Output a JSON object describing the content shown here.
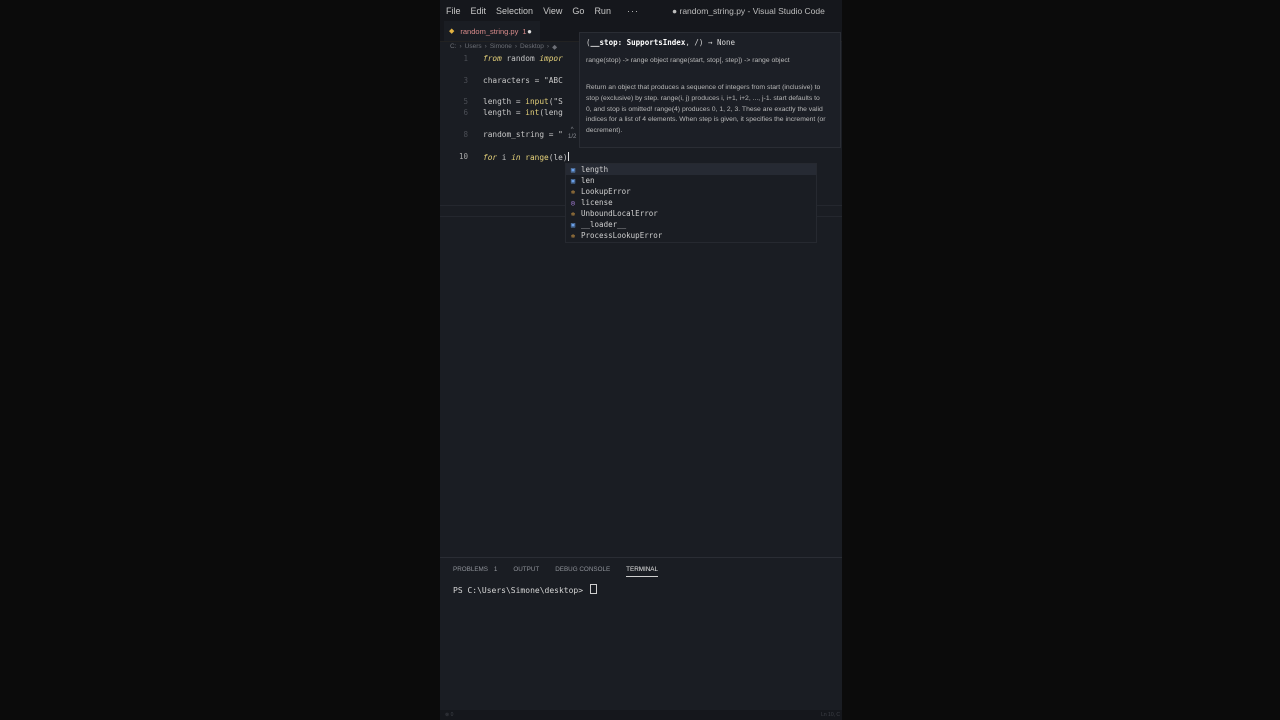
{
  "titlebar": {
    "menu": [
      "File",
      "Edit",
      "Selection",
      "View",
      "Go",
      "Run"
    ],
    "more": "···",
    "window_title": "● random_string.py - Visual Studio Code"
  },
  "tab": {
    "icon": "◆",
    "name": "random_string.py",
    "problem_count": "1",
    "dirty": "●"
  },
  "breadcrumb": [
    "C:",
    "›",
    "Users",
    "›",
    "Simone",
    "›",
    "Desktop",
    "›",
    "◆"
  ],
  "editor": {
    "lines": [
      {
        "num": "1",
        "parts": [
          {
            "t": "from",
            "c": "kw"
          },
          {
            "t": " random ",
            "c": ""
          },
          {
            "t": "impor",
            "c": "kw"
          }
        ]
      },
      {
        "num": "2",
        "parts": []
      },
      {
        "num": "3",
        "parts": [
          {
            "t": "characters = \"ABC",
            "c": ""
          }
        ]
      },
      {
        "num": "4",
        "parts": []
      },
      {
        "num": "5",
        "parts": [
          {
            "t": "length = ",
            "c": ""
          },
          {
            "t": "input",
            "c": "fn"
          },
          {
            "t": "(\"S",
            "c": ""
          }
        ]
      },
      {
        "num": "6",
        "parts": [
          {
            "t": "length = ",
            "c": ""
          },
          {
            "t": "int",
            "c": "fn"
          },
          {
            "t": "(leng",
            "c": ""
          }
        ]
      },
      {
        "num": "7",
        "parts": []
      },
      {
        "num": "8",
        "parts": [
          {
            "t": "random_string = \"",
            "c": ""
          }
        ]
      },
      {
        "num": "9",
        "parts": []
      },
      {
        "num": "10",
        "parts": [
          {
            "t": "for",
            "c": "kw"
          },
          {
            "t": " i ",
            "c": ""
          },
          {
            "t": "in",
            "c": "kw"
          },
          {
            "t": " ",
            "c": ""
          },
          {
            "t": "range",
            "c": "fn"
          },
          {
            "t": "(le)",
            "c": ""
          }
        ]
      }
    ]
  },
  "hover": {
    "signature_pre": "(",
    "signature_param": "__stop: SupportsIndex",
    "signature_post": ", /) → None",
    "summary": "range(stop) -> range object range(start, stop[, step]) -> range object",
    "description": "Return an object that produces a sequence of integers from start (inclusive) to stop (exclusive) by step. range(i, j) produces i, i+1, i+2, ..., j-1. start defaults to 0, and stop is omitted! range(4) produces 0, 1, 2, 3. These are exactly the valid indices for a list of 4 elements. When step is given, it specifies the increment (or decrement).",
    "counter_up": "^",
    "counter": "1/2",
    "counter_down": "v"
  },
  "suggest": [
    {
      "icon": "var",
      "glyph": "▣",
      "label": "length"
    },
    {
      "icon": "var",
      "glyph": "▣",
      "label": "len"
    },
    {
      "icon": "cls",
      "glyph": "✲",
      "label": "LookupError"
    },
    {
      "icon": "fn",
      "glyph": "◎",
      "label": "license"
    },
    {
      "icon": "cls",
      "glyph": "✲",
      "label": "UnboundLocalError"
    },
    {
      "icon": "var",
      "glyph": "▣",
      "label": "__loader__"
    },
    {
      "icon": "cls",
      "glyph": "✲",
      "label": "ProcessLookupError"
    }
  ],
  "panel": {
    "tabs": [
      {
        "label": "PROBLEMS",
        "badge": "1"
      },
      {
        "label": "OUTPUT",
        "badge": ""
      },
      {
        "label": "DEBUG CONSOLE",
        "badge": ""
      },
      {
        "label": "TERMINAL",
        "badge": ""
      }
    ],
    "active_tab": "TERMINAL",
    "prompt": "PS C:\\Users\\Simone\\desktop> "
  },
  "statusbar": {
    "left": "⊗ 0",
    "right": "Ln 10, C"
  }
}
